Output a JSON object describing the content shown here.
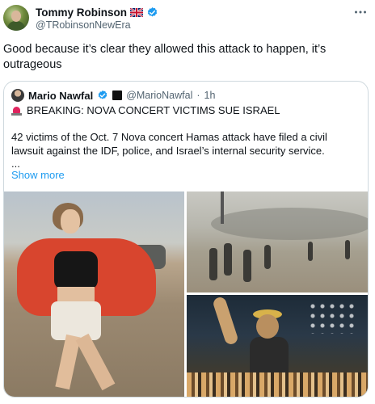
{
  "tweet": {
    "author_name": "Tommy Robinson",
    "author_handle": "@TRobinsonNewEra",
    "flag_icon": "uk-flag-icon",
    "verified_icon": "verified-badge-icon",
    "text": "Good because it’s clear they allowed this attack to happen, it’s outrageous",
    "more_icon": "more-horizontal-icon"
  },
  "quoted_tweet": {
    "author_name": "Mario Nawfal",
    "author_handle": "@MarioNawfal",
    "separator": "·",
    "time": "1h",
    "headline_icon": "siren-icon",
    "headline": "BREAKING: NOVA CONCERT VICTIMS SUE ISRAEL",
    "body": "42 victims of the Oct. 7 Nova concert Hamas attack have filed a civil lawsuit against the IDF, police, and Israel’s internal security service.",
    "ellipsis": "...",
    "show_more": "Show more"
  },
  "colors": {
    "text_primary": "#0f1419",
    "text_secondary": "#536471",
    "link": "#1d9bf0",
    "verified": "#1d9bf0",
    "border": "#cfd9de"
  }
}
